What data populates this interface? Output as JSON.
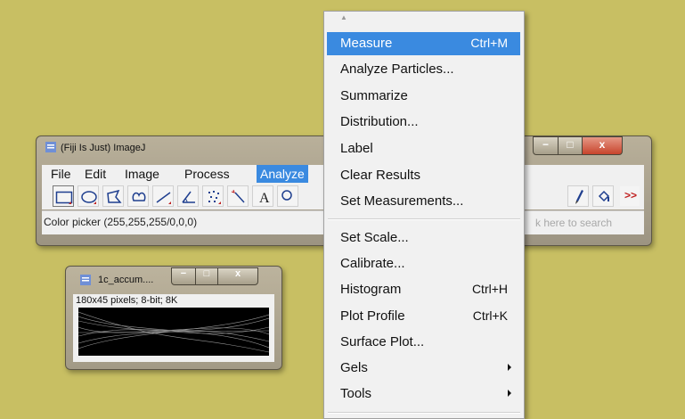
{
  "imagej_window": {
    "title": "(Fiji Is Just) ImageJ",
    "menu": [
      "File",
      "Edit",
      "Image",
      "Process",
      "Analyze"
    ],
    "active_menu": "Analyze",
    "status_text": "Color picker (255,255,255/0,0,0)",
    "search_hint": "k here to search",
    "more_tools_label": ">>",
    "text_tool_label": "A",
    "controls": {
      "min": "−",
      "max": "□",
      "close": "x"
    }
  },
  "image_window": {
    "title": "1c_accum....",
    "info": "180x45 pixels; 8-bit; 8K",
    "controls": {
      "min": "−",
      "max": "□",
      "close": "x"
    }
  },
  "analyze_menu": {
    "items": [
      {
        "label": "Measure",
        "shortcut": "Ctrl+M",
        "highlighted": true
      },
      {
        "label": "Analyze Particles...",
        "shortcut": ""
      },
      {
        "label": "Summarize",
        "shortcut": ""
      },
      {
        "label": "Distribution...",
        "shortcut": ""
      },
      {
        "label": "Label",
        "shortcut": ""
      },
      {
        "label": "Clear Results",
        "shortcut": ""
      },
      {
        "label": "Set Measurements...",
        "shortcut": ""
      },
      {
        "label": "Set Scale...",
        "shortcut": ""
      },
      {
        "label": "Calibrate...",
        "shortcut": ""
      },
      {
        "label": "Histogram",
        "shortcut": "Ctrl+H"
      },
      {
        "label": "Plot Profile",
        "shortcut": "Ctrl+K"
      },
      {
        "label": "Surface Plot...",
        "shortcut": ""
      },
      {
        "label": "Gels",
        "submenu": true
      },
      {
        "label": "Tools",
        "submenu": true
      }
    ]
  },
  "colors": {
    "desktop": "#c8bf63",
    "highlight": "#3a8ae0",
    "close_button": "#c7442c"
  }
}
